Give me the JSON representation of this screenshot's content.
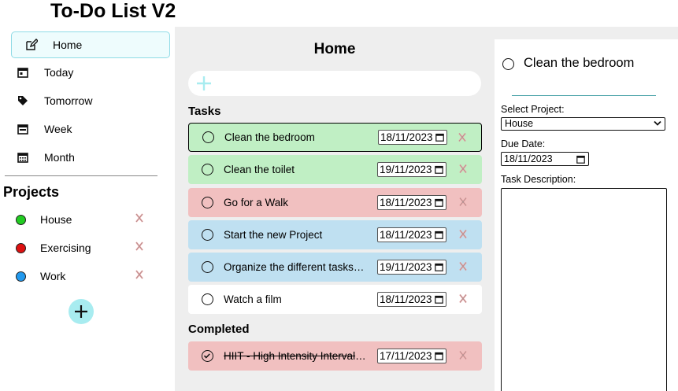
{
  "app": {
    "title": "To-Do List V2"
  },
  "sidebar": {
    "nav": [
      {
        "label": "Home",
        "icon": "edit-icon"
      },
      {
        "label": "Today",
        "icon": "calendar-day-icon"
      },
      {
        "label": "Tomorrow",
        "icon": "tag-icon"
      },
      {
        "label": "Week",
        "icon": "calendar-week-icon"
      },
      {
        "label": "Month",
        "icon": "calendar-month-icon"
      }
    ],
    "projects_heading": "Projects",
    "projects": [
      {
        "label": "House",
        "color": "#22cc22"
      },
      {
        "label": "Exercising",
        "color": "#dd1111"
      },
      {
        "label": "Work",
        "color": "#2299ee"
      }
    ]
  },
  "main": {
    "title": "Home",
    "tasks_heading": "Tasks",
    "completed_heading": "Completed",
    "tasks": [
      {
        "name": "Clean the bedroom",
        "date": "18/11/2023",
        "color": "#c0efc4"
      },
      {
        "name": "Clean the toilet",
        "date": "19/11/2023",
        "color": "#c0efc4"
      },
      {
        "name": "Go for a Walk",
        "date": "18/11/2023",
        "color": "#f1c0c0"
      },
      {
        "name": "Start the new Project",
        "date": "18/11/2023",
        "color": "#bfe0f1"
      },
      {
        "name": "Organize the different tasks o...",
        "date": "19/11/2023",
        "color": "#bfe0f1"
      },
      {
        "name": "Watch a film",
        "date": "18/11/2023",
        "color": "#ffffff"
      }
    ],
    "completed": [
      {
        "name": "HIIT - High Intensity Interval T...",
        "date": "17/11/2023",
        "color": "#f1c0c0"
      }
    ]
  },
  "detail": {
    "title": "Clean the bedroom",
    "project_label": "Select Project:",
    "project_value": "House",
    "due_label": "Due Date:",
    "due_value": "18/11/2023",
    "desc_label": "Task Description:"
  }
}
